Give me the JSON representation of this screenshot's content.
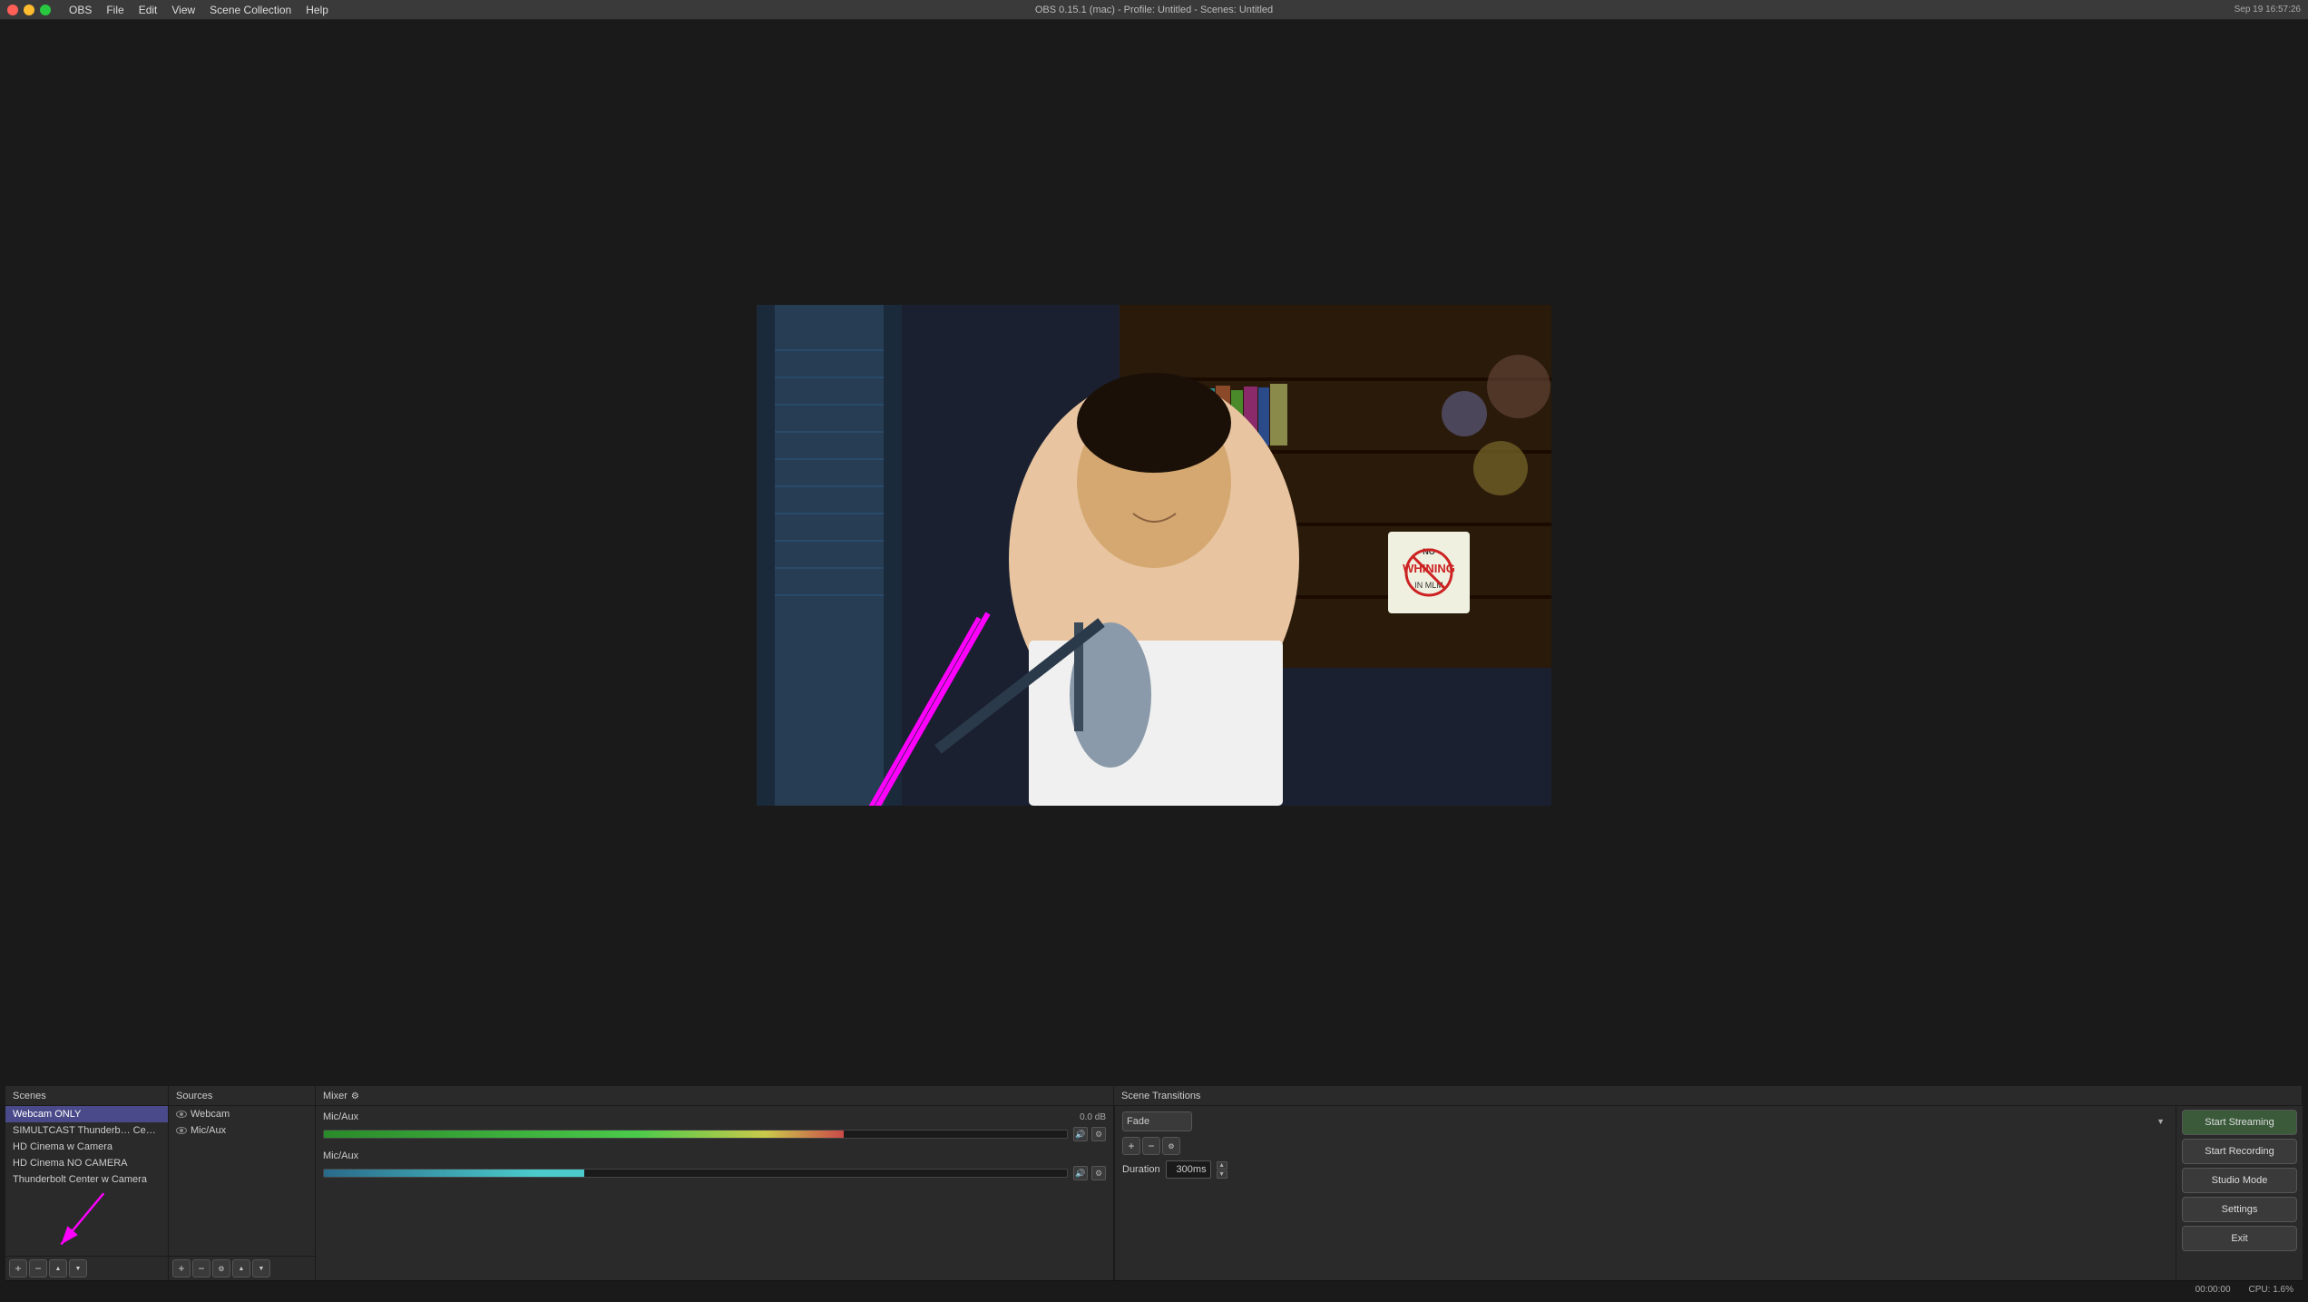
{
  "titlebar": {
    "title": "OBS 0.15.1 (mac) - Profile: Untitled - Scenes: Untitled",
    "menu": [
      "OBS",
      "File",
      "Edit",
      "View",
      "Scene Collection",
      "Help"
    ],
    "time": "Sep 19  16:57:26"
  },
  "scenes": {
    "label": "Scenes",
    "items": [
      {
        "name": "Webcam ONLY",
        "active": true
      },
      {
        "name": "SIMULTCAST Thunderbolt Center NO CA"
      },
      {
        "name": "HD Cinema w Camera"
      },
      {
        "name": "HD Cinema NO CAMERA"
      },
      {
        "name": "Thunderbolt Center w Camera"
      }
    ]
  },
  "sources": {
    "label": "Sources",
    "items": [
      {
        "name": "Webcam",
        "visible": true
      },
      {
        "name": "Mic/Aux",
        "visible": true
      }
    ]
  },
  "mixer": {
    "label": "Mixer",
    "channels": [
      {
        "name": "Mic/Aux",
        "db": "0.0 dB",
        "level": 60
      },
      {
        "name": "Mic/Aux",
        "db": "",
        "level": 30
      }
    ]
  },
  "transitions": {
    "label": "Scene Transitions",
    "type": "Fade",
    "duration_label": "Duration",
    "duration_value": "300ms"
  },
  "buttons": {
    "start_streaming": "Start Streaming",
    "start_recording": "Start Recording",
    "studio_mode": "Studio Mode",
    "settings": "Settings",
    "exit": "Exit"
  },
  "statusbar": {
    "time": "00:00:00",
    "cpu": "CPU: 1.6%"
  },
  "toolbar": {
    "add": "+",
    "remove": "−",
    "up": "▲",
    "down": "▼",
    "cog": "⚙"
  }
}
